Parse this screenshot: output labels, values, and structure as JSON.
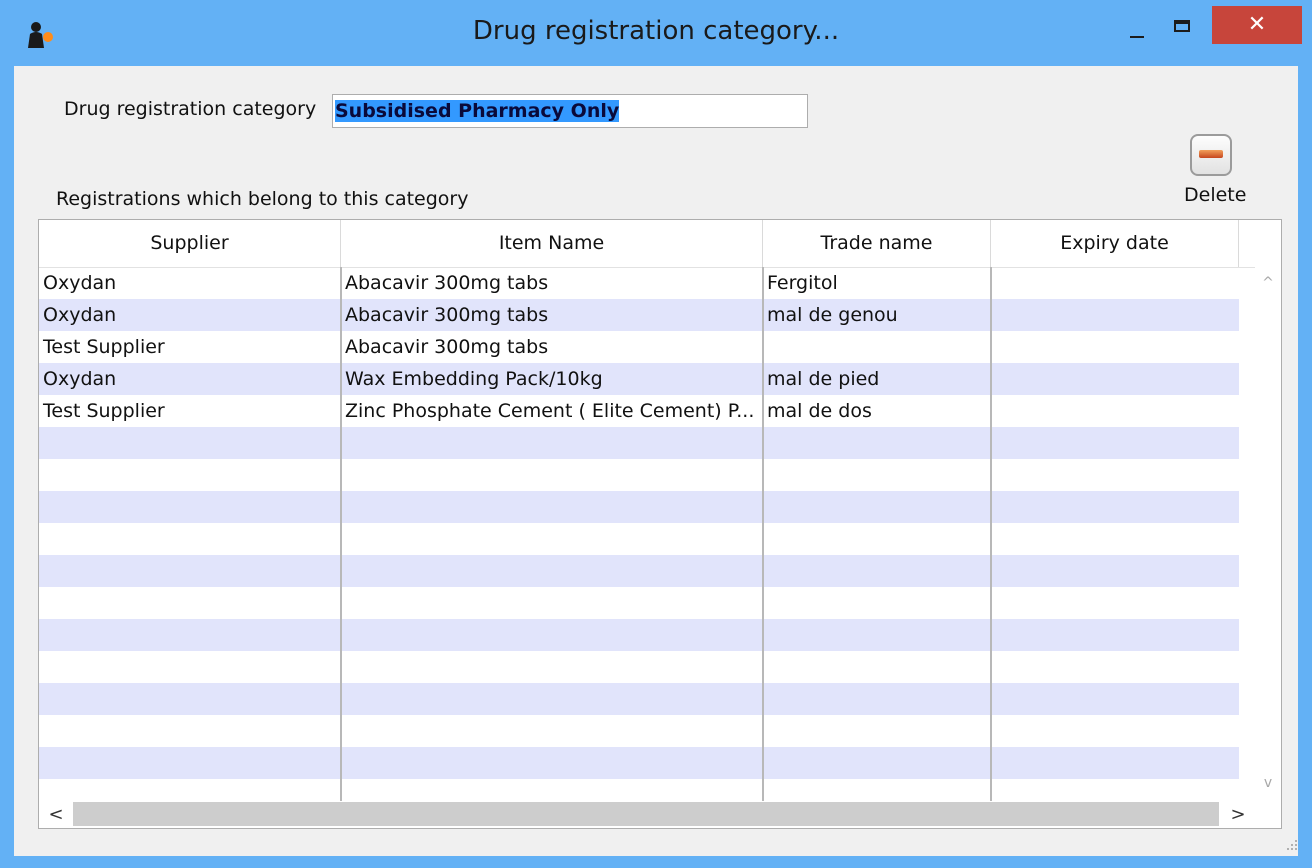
{
  "window": {
    "title": "Drug registration category...",
    "close_glyph": "✕",
    "icon": "mSupply-person-icon"
  },
  "form": {
    "category_label": "Drug registration category",
    "category_value": "Subsidised Pharmacy Only",
    "registrations_label": "Registrations which belong to this category",
    "delete_label": "Delete"
  },
  "table": {
    "columns": [
      "Supplier",
      "Item Name",
      "Trade name",
      "Expiry date"
    ],
    "rows": [
      {
        "supplier": "Oxydan",
        "item_name": "Abacavir 300mg tabs",
        "trade_name": "Fergitol",
        "expiry_date": ""
      },
      {
        "supplier": "Oxydan",
        "item_name": "Abacavir 300mg tabs",
        "trade_name": "mal de genou",
        "expiry_date": ""
      },
      {
        "supplier": "Test Supplier",
        "item_name": "Abacavir 300mg tabs",
        "trade_name": "",
        "expiry_date": ""
      },
      {
        "supplier": "Oxydan",
        "item_name": "Wax Embedding Pack/10kg",
        "trade_name": "mal de pied",
        "expiry_date": ""
      },
      {
        "supplier": "Test Supplier",
        "item_name": "Zinc Phosphate Cement ( Elite Cement) P...",
        "trade_name": "mal de dos",
        "expiry_date": ""
      }
    ],
    "scroll_left_glyph": "<",
    "scroll_right_glyph": ">",
    "scroll_up_glyph": "^",
    "scroll_down_glyph": "v"
  },
  "colors": {
    "titlebar": "#63b1f5",
    "alt_row": "#e1e4fb",
    "close_button": "#c7453b",
    "selection": "#3399ff"
  }
}
